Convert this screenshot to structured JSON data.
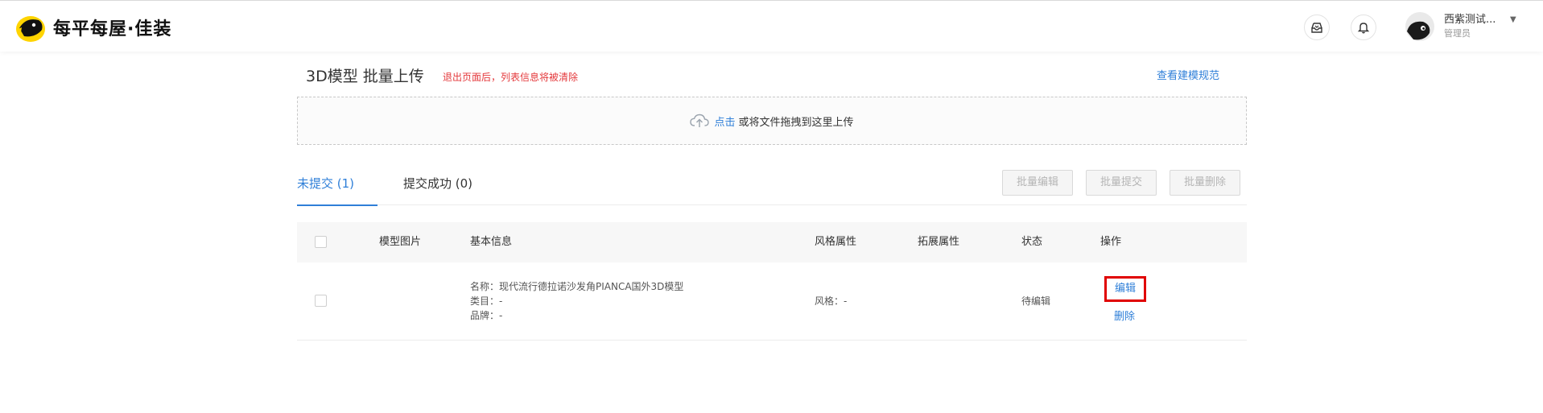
{
  "header": {
    "brand": "每平每屋·佳装",
    "icons": [
      "inbox-icon",
      "bell-icon"
    ],
    "user": {
      "name": "西紫测试...",
      "role": "管理员"
    }
  },
  "page": {
    "title": "3D模型 批量上传",
    "warning": "退出页面后，列表信息将被清除",
    "spec_link": "查看建模规范"
  },
  "upload": {
    "click_text": "点击",
    "hint": "或将文件拖拽到这里上传"
  },
  "tabs": [
    {
      "label": "未提交 (1)",
      "active": true
    },
    {
      "label": "提交成功 (0)",
      "active": false
    }
  ],
  "batch_buttons": [
    "批量编辑",
    "批量提交",
    "批量删除"
  ],
  "table": {
    "columns": [
      "模型图片",
      "基本信息",
      "风格属性",
      "拓展属性",
      "状态",
      "操作"
    ],
    "rows": [
      {
        "name": "名称：现代流行德拉诺沙发角PIANCA国外3D模型",
        "category": "类目：-",
        "brand": "品牌：-",
        "style": "风格：-",
        "status": "待编辑",
        "edit": "编辑",
        "delete": "删除"
      }
    ]
  },
  "colors": {
    "accent": "#2f7fd8",
    "warning": "#e4393c",
    "highlight": "#e00000"
  }
}
